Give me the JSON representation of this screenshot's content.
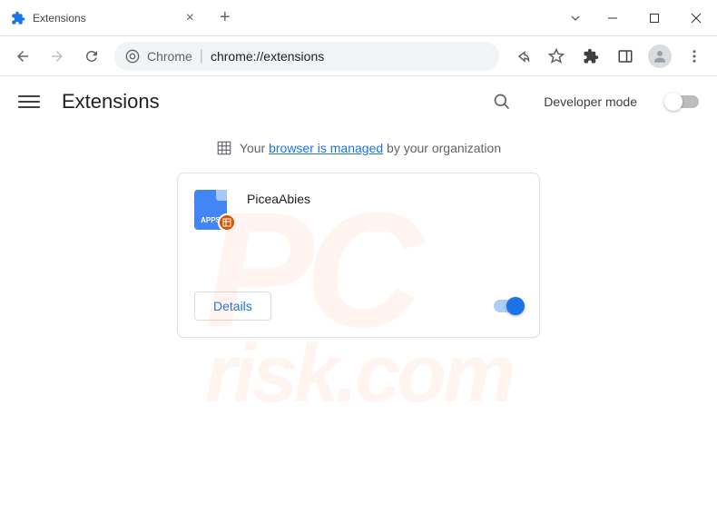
{
  "window": {
    "tab_title": "Extensions",
    "new_tab_tooltip": "New tab"
  },
  "toolbar": {
    "url_prefix": "Chrome",
    "url_text": "chrome://extensions"
  },
  "header": {
    "title": "Extensions",
    "dev_mode_label": "Developer mode",
    "dev_mode_enabled": false
  },
  "managed": {
    "prefix": "Your ",
    "link_text": "browser is managed",
    "suffix": " by your organization"
  },
  "extension": {
    "name": "PiceaAbies",
    "icon_label": "APPS",
    "details_label": "Details",
    "enabled": true
  },
  "watermark": {
    "line1": "PC",
    "line2": "risk.com"
  }
}
